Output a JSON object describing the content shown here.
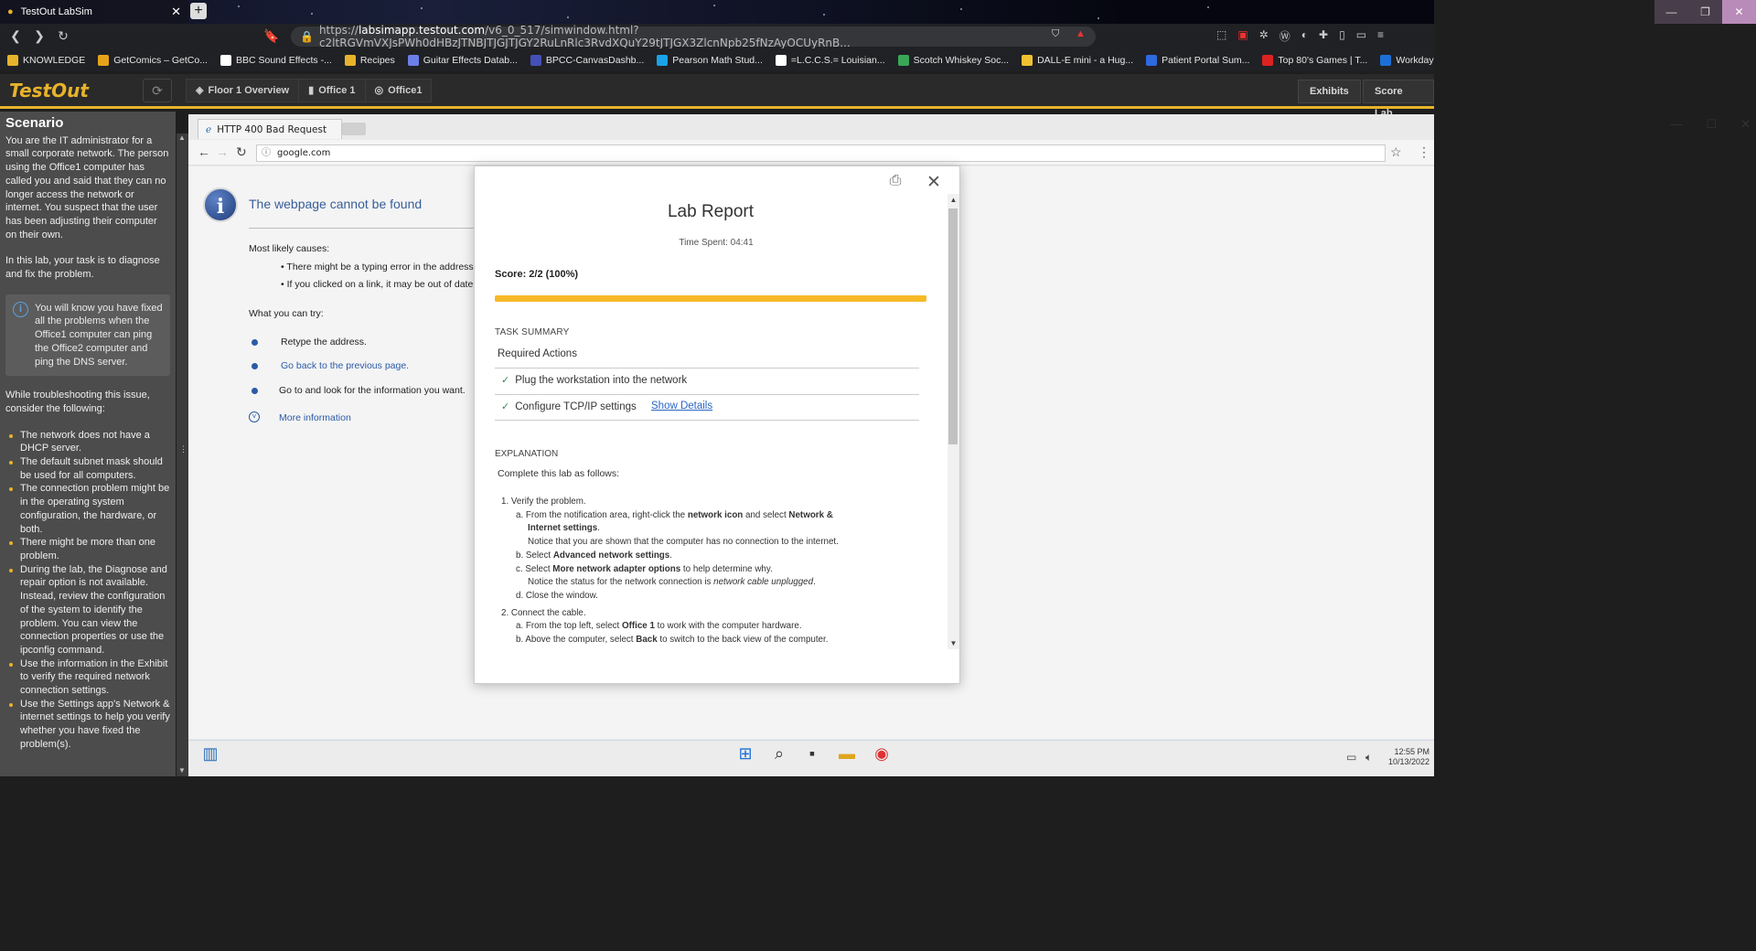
{
  "browser": {
    "tab_title": "TestOut LabSim",
    "url_prefix": "https://",
    "url_host": "labsimapp.testout.com",
    "url_path": "/v6_0_517/simwindow.html?c2ltRGVmVXJsPWh0dHBzJTNBJTJGJTJGY2RuLnRlc3RvdXQuY29tJTJGX3ZlcnNpb25fNzAyOCUyRnB...",
    "bookmarks": [
      "KNOWLEDGE",
      "GetComics – GetCo...",
      "BBC Sound Effects -...",
      "Recipes",
      "Guitar Effects Datab...",
      "BPCC-CanvasDashb...",
      "Pearson Math Stud...",
      "=L.C.C.S.= Louisian...",
      "Scotch Whiskey Soc...",
      "DALL-E mini - a Hug...",
      "Patient Portal Sum...",
      "Top 80's Games | T...",
      "Workday wholefoo..."
    ]
  },
  "toolbar": {
    "logo": "TestOut",
    "crumbs": [
      "Floor 1 Overview",
      "Office 1",
      "Office1"
    ],
    "exhibits": "Exhibits",
    "score_lab": "Score Lab"
  },
  "scenario": {
    "title": "Scenario",
    "intro": "You are the IT administrator for a small corporate network. The person using the Office1 computer has called you and said that they can no longer access the network or internet. You suspect that the user has been adjusting their computer on their own.",
    "task": "In this lab, your task is to diagnose and fix the problem.",
    "tip": "You will know you have fixed all the problems when the Office1 computer can ping the Office2 computer and ping the DNS server.",
    "consider_intro": "While troubleshooting this issue, consider the following:",
    "considerations": [
      "The network does not have a DHCP server.",
      "The default subnet mask should be used for all computers.",
      "The connection problem might be in the operating system configuration, the hardware, or both.",
      "There might be more than one problem.",
      "During the lab, the Diagnose and repair option is not available. Instead, review the configuration of the system to identify the problem. You can view the connection properties or use the ipconfig command.",
      "Use the information in the Exhibit to verify the required network connection settings.",
      "Use the Settings app's Network & internet settings to help you verify whether you have fixed the problem(s)."
    ]
  },
  "inner_browser": {
    "tab_title": "HTTP 400 Bad Request",
    "address": "google.com",
    "error_title": "The webpage cannot be found",
    "causes_label": "Most likely causes:",
    "causes": [
      "There might be a typing error in the address.",
      "If you clicked on a link, it may be out of date."
    ],
    "try_label": "What you can try:",
    "tries": [
      "Retype the address.",
      "Go back to the previous page.",
      "Go to  and look for the information you want."
    ],
    "more_info": "More information"
  },
  "taskbar": {
    "time": "12:55 PM",
    "date": "10/13/2022"
  },
  "report": {
    "title": "Lab Report",
    "time_spent": "Time Spent: 04:41",
    "score": "Score: 2/2 (100%)",
    "score_fraction": 1.0,
    "task_summary": "TASK SUMMARY",
    "required_actions": "Required Actions",
    "tasks": [
      "Plug the workstation into the network",
      "Configure TCP/IP settings"
    ],
    "show_details": "Show Details",
    "explanation": "EXPLANATION",
    "explanation_intro": "Complete this lab as follows:"
  },
  "colors": {
    "accent": "#e7b32b",
    "progress": "#f7b928",
    "link": "#2a66c2"
  }
}
